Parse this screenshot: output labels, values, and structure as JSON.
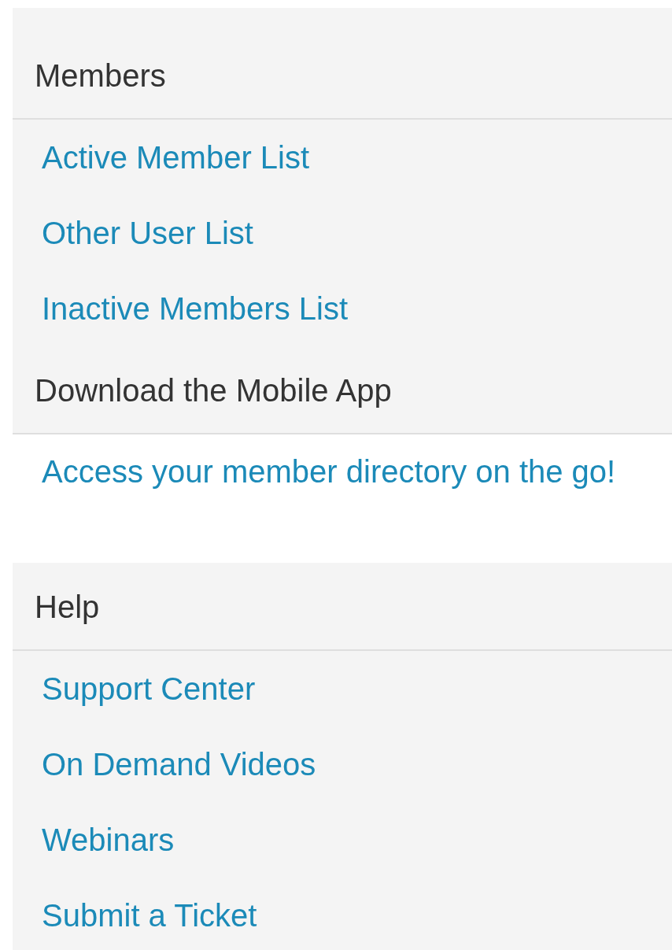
{
  "sections": [
    {
      "heading": "Members",
      "kind": "links",
      "items": [
        "Active Member List",
        "Other User List",
        "Inactive Members List"
      ]
    },
    {
      "heading": "Download the Mobile App",
      "kind": "promo",
      "items": [
        "Access your member directory on the go!"
      ]
    },
    {
      "heading": "Help",
      "kind": "links",
      "items": [
        "Support Center",
        "On Demand Videos",
        "Webinars",
        "Submit a Ticket"
      ]
    }
  ]
}
